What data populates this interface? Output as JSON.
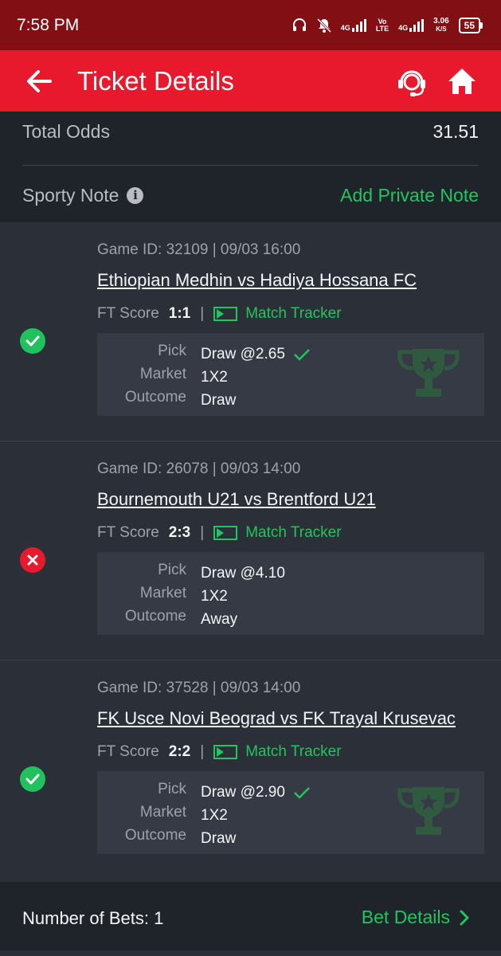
{
  "status_bar": {
    "time": "7:58 PM",
    "net1": "4G",
    "net2_top": "Vo",
    "net2_bottom": "LTE",
    "net3": "4G",
    "speed_value": "3.06",
    "speed_unit": "K/S",
    "battery": "55",
    "icons": [
      "headset-icon",
      "bell-muted-icon",
      "signal-icon",
      "signal-icon"
    ]
  },
  "header": {
    "title": "Ticket Details",
    "icons": [
      "back-arrow-icon",
      "customer-support-icon",
      "home-icon"
    ],
    "color": "#e8192c"
  },
  "summary": {
    "total_odds_label": "Total Odds",
    "total_odds_value": "31.51",
    "note_label": "Sporty Note",
    "add_note_label": "Add Private Note"
  },
  "bets": [
    {
      "status": "won",
      "game_id": "Game ID: 32109 | 09/03 16:00",
      "match": "Ethiopian Medhin vs Hadiya Hossana FC",
      "ft_label": "FT Score",
      "ft_score": "1:1",
      "tracker_label": "Match Tracker",
      "pick_label": "Pick",
      "pick_value": "Draw @2.65",
      "market_label": "Market",
      "market_value": "1X2",
      "outcome_label": "Outcome",
      "outcome_value": "Draw"
    },
    {
      "status": "lost",
      "game_id": "Game ID: 26078 | 09/03 14:00",
      "match": "Bournemouth U21 vs Brentford U21",
      "ft_label": "FT Score",
      "ft_score": "2:3",
      "tracker_label": "Match Tracker",
      "pick_label": "Pick",
      "pick_value": "Draw @4.10",
      "market_label": "Market",
      "market_value": "1X2",
      "outcome_label": "Outcome",
      "outcome_value": "Away"
    },
    {
      "status": "won",
      "game_id": "Game ID: 37528 | 09/03 14:00",
      "match": "FK Usce Novi Beograd vs FK Trayal Krusevac",
      "ft_label": "FT Score",
      "ft_score": "2:2",
      "tracker_label": "Match Tracker",
      "pick_label": "Pick",
      "pick_value": "Draw @2.90",
      "market_label": "Market",
      "market_value": "1X2",
      "outcome_label": "Outcome",
      "outcome_value": "Draw"
    }
  ],
  "footer": {
    "count_label": "Number of Bets: 1",
    "link_label": "Bet Details"
  },
  "colors": {
    "accent_green": "#22c55e",
    "won": "#1fc25c",
    "lost": "#e8192c",
    "status_bar": "#820f14"
  }
}
